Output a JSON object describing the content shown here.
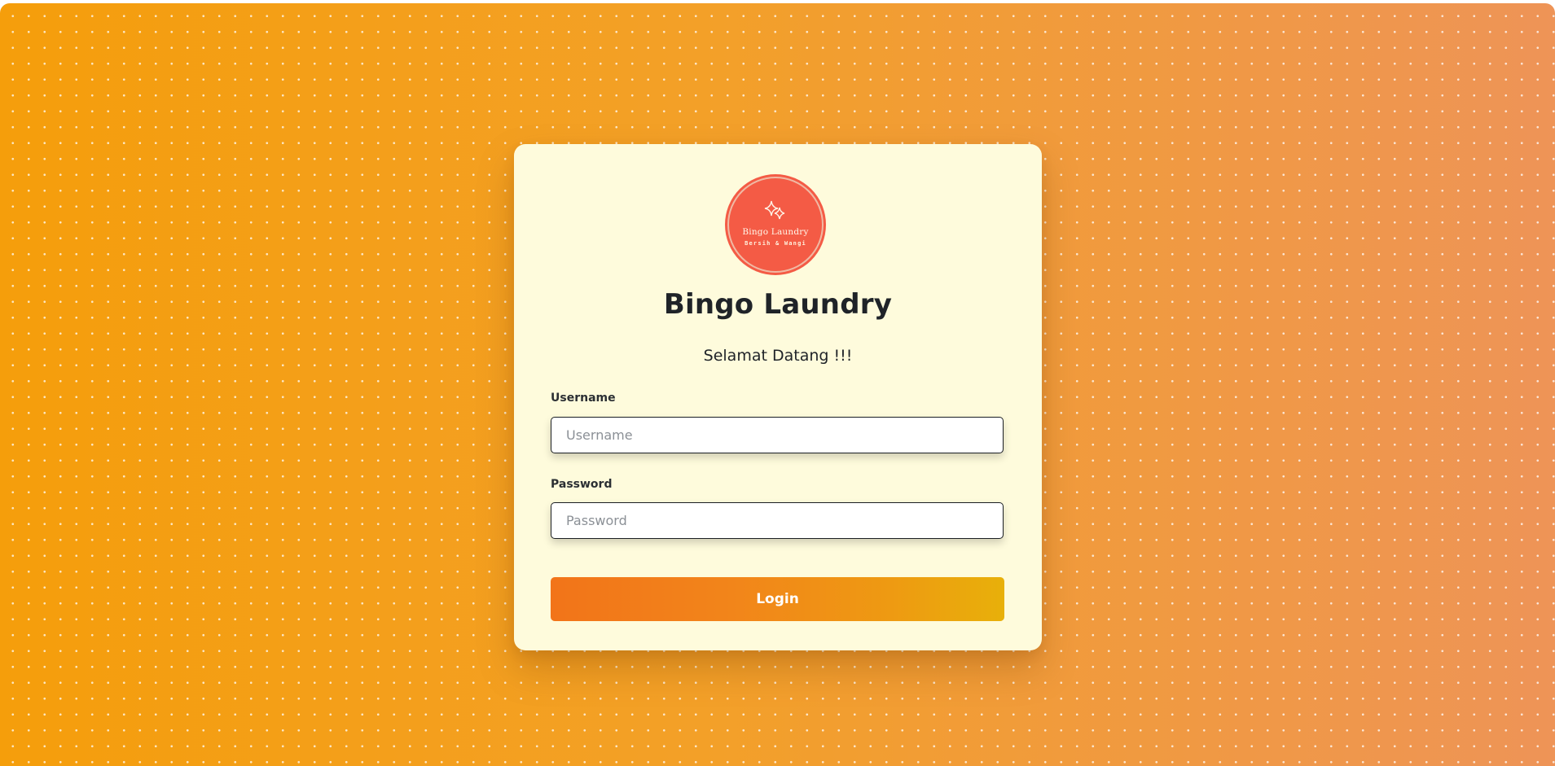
{
  "logo": {
    "title": "Bingo Laundry",
    "subtitle": "Bersih & Wangi",
    "icon": "sparkle-icon",
    "color": "#f45b45"
  },
  "brand": {
    "name": "Bingo Laundry"
  },
  "welcome": "Selamat Datang !!!",
  "form": {
    "username_label": "Username",
    "username_placeholder": "Username",
    "username_value": "",
    "password_label": "Password",
    "password_placeholder": "Password",
    "password_value": "",
    "login_label": "Login"
  },
  "colors": {
    "background_start": "#f59e0b",
    "background_end": "#ee9457",
    "card": "#fefbdc",
    "button_start": "#f27419",
    "button_end": "#e8b00a"
  }
}
